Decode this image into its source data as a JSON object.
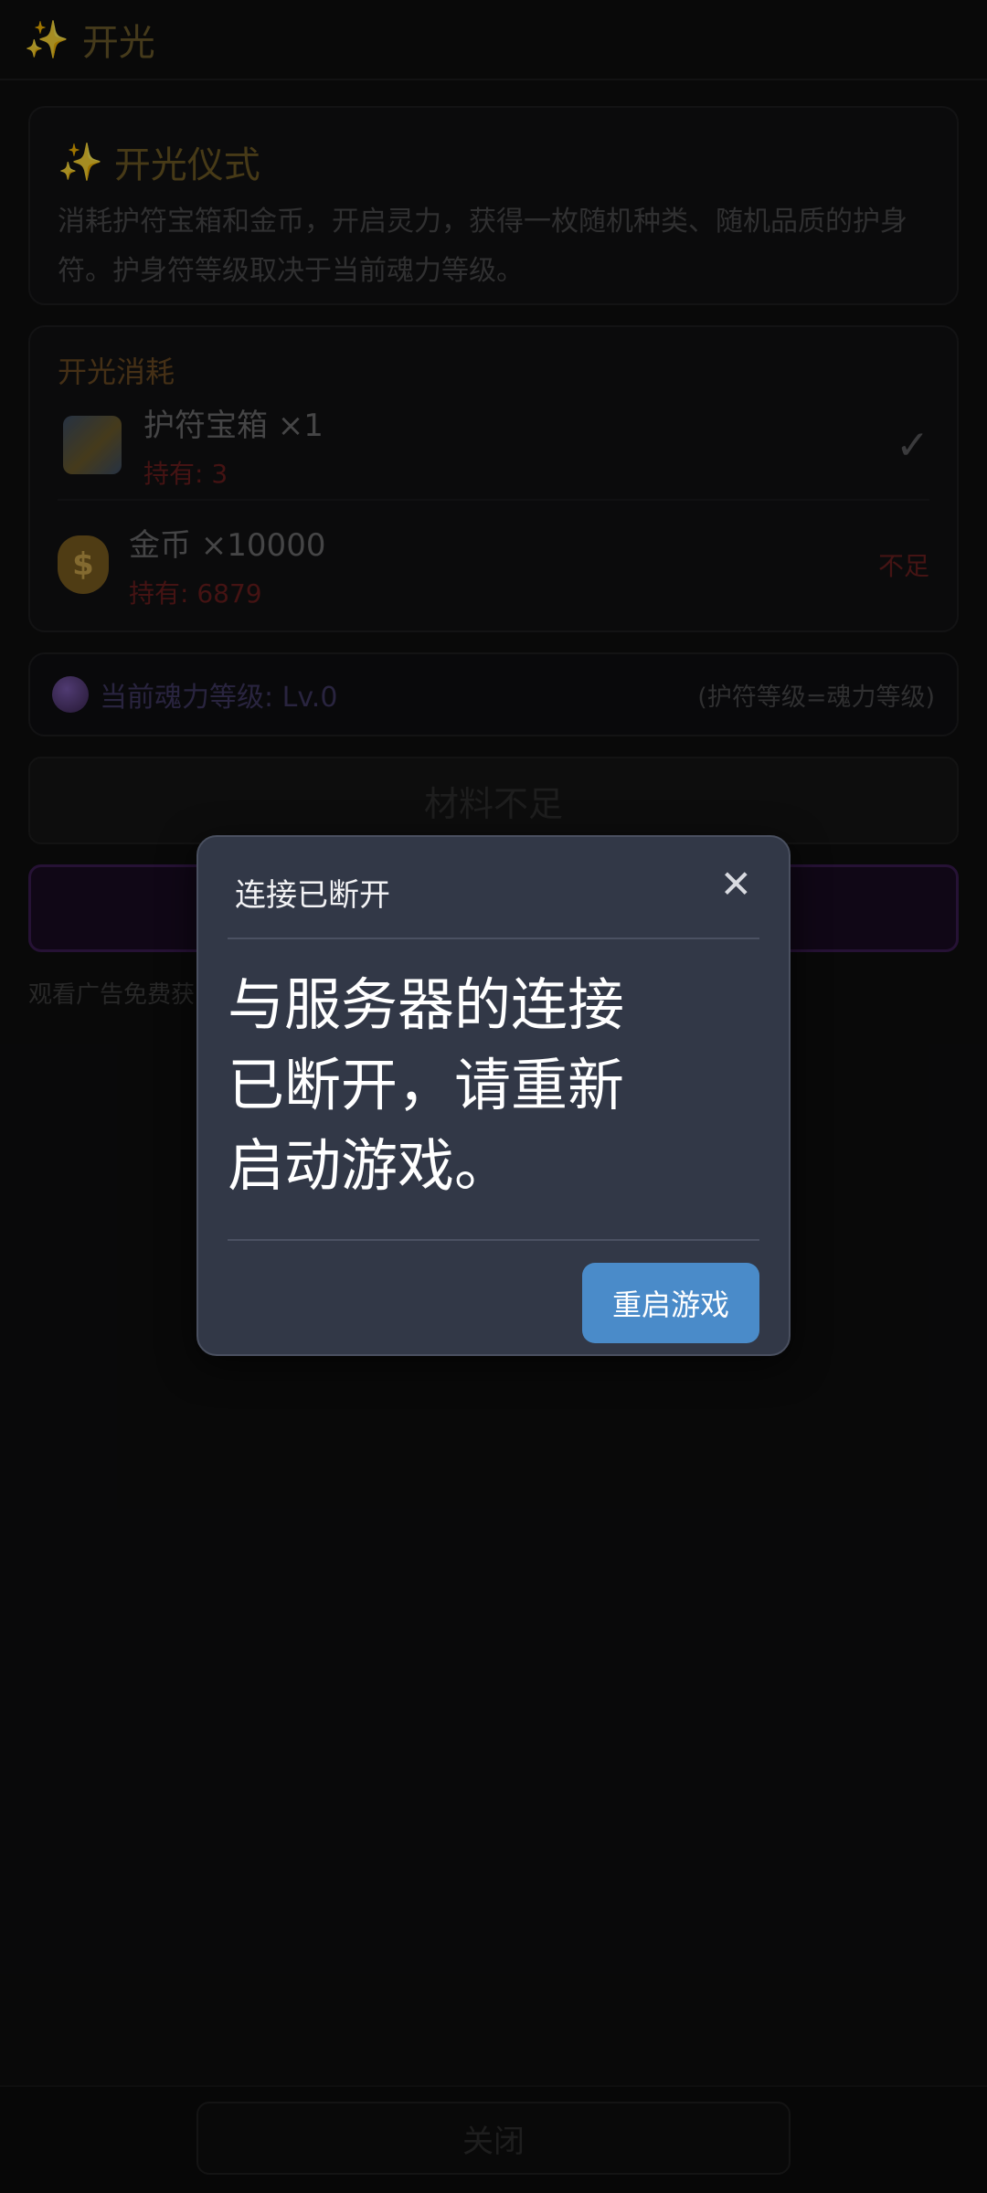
{
  "header": {
    "icon": "sparkles-icon",
    "title": "开光"
  },
  "capsule": {
    "more_icon": "more-dots-icon",
    "close_icon": "target-circle-icon"
  },
  "intro": {
    "title": "开光仪式",
    "description": "消耗护符宝箱和金币，开启灵力，获得一枚随机种类、随机品质的护身符。护身符等级取决于当前魂力等级。"
  },
  "cost": {
    "label": "开光消耗",
    "items": [
      {
        "icon": "treasure-chest-icon",
        "name": "护符宝箱 ×1",
        "owned": "持有: 3",
        "status": "✓",
        "status_type": "ok"
      },
      {
        "icon": "money-bag-icon",
        "name": "金币 ×10000",
        "owned": "持有: 6879",
        "status": "不足",
        "status_type": "lack"
      }
    ]
  },
  "level": {
    "icon": "crystal-ball-icon",
    "text": "当前魂力等级: Lv.0",
    "hint": "(护符等级=魂力等级)"
  },
  "actions": {
    "lack_label": "材料不足",
    "ad_note": "观看广告免费获"
  },
  "footer": {
    "close_label": "关闭"
  },
  "dialog": {
    "title": "连接已断开",
    "message": "与服务器的连接已断开，请重新启动游戏。",
    "button": "重启游戏"
  },
  "colors": {
    "accent_gold": "#6b5a2a",
    "dialog_bg": "#323847",
    "restart_button": "#4a8bc9",
    "lack_red": "#6b2020"
  }
}
